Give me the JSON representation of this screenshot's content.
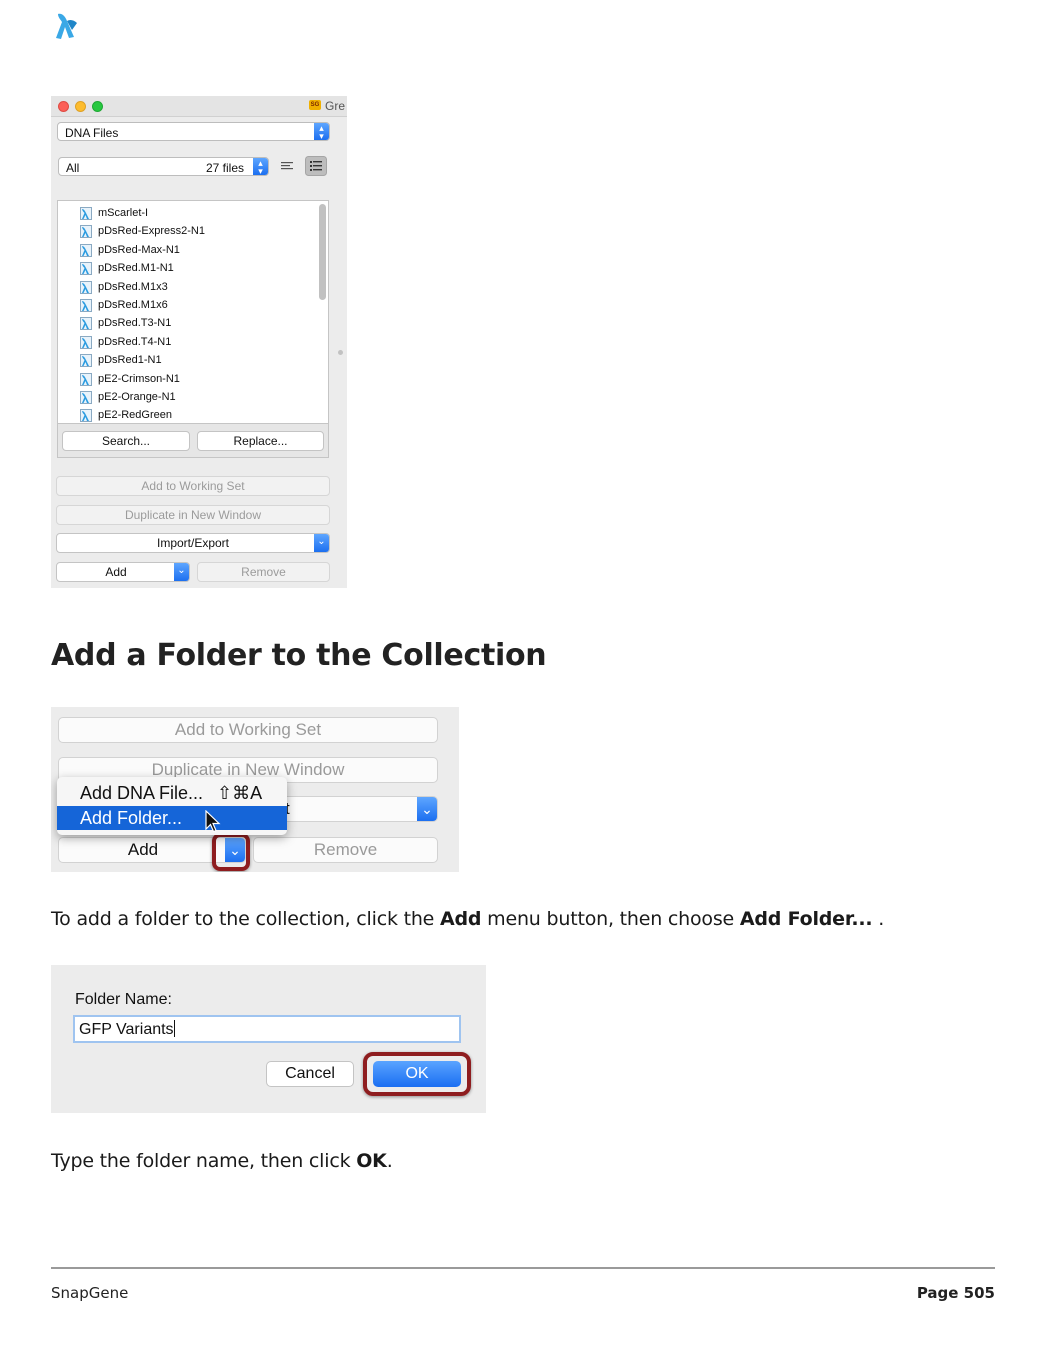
{
  "window": {
    "title": "Gre",
    "badge": "SG",
    "file_type_popup": "DNA Files",
    "filter_popup": "All",
    "file_count": "27 files",
    "files": [
      "mScarlet-I",
      "pDsRed-Express2-N1",
      "pDsRed-Max-N1",
      "pDsRed.M1-N1",
      "pDsRed.M1x3",
      "pDsRed.M1x6",
      "pDsRed.T3-N1",
      "pDsRed.T4-N1",
      "pDsRed1-N1",
      "pE2-Crimson-N1",
      "pE2-Orange-N1",
      "pE2-RedGreen"
    ],
    "search_button": "Search...",
    "replace_button": "Replace...",
    "add_to_working_set": "Add to Working Set",
    "duplicate_in_new_window": "Duplicate in New Window",
    "import_export": "Import/Export",
    "add_button": "Add",
    "remove_button": "Remove"
  },
  "heading": "Add a Folder to the Collection",
  "add_menu_shot": {
    "add_to_working_set": "Add to Working Set",
    "duplicate_in_new_window": "Duplicate in New Window",
    "hidden_fragment": "t",
    "menu_items": [
      {
        "label": "Add DNA File...",
        "shortcut": "⇧⌘A",
        "selected": false
      },
      {
        "label": "Add Folder...",
        "shortcut": "",
        "selected": true
      }
    ],
    "add_button": "Add",
    "remove_button": "Remove"
  },
  "instruction1": {
    "pre": "To add a folder to the collection, click the ",
    "b1": "Add",
    "mid": " menu button, then choose ",
    "b2": "Add Folder...",
    "post": " ."
  },
  "folder_dialog": {
    "label": "Folder Name:",
    "value": "GFP Variants",
    "cancel": "Cancel",
    "ok": "OK"
  },
  "instruction2": {
    "pre": "Type the folder name, then click ",
    "b1": "OK",
    "post": "."
  },
  "footer": {
    "left": "SnapGene",
    "right": "Page 505"
  },
  "colors": {
    "accent_blue": "#1c6ff0",
    "highlight_ring": "#8e1d1f",
    "menu_selection": "#1565d8"
  }
}
